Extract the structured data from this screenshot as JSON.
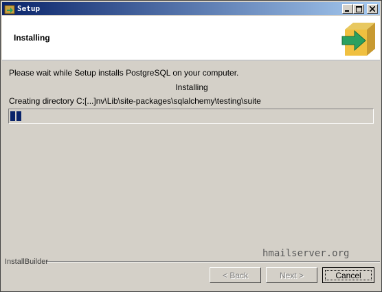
{
  "window": {
    "title": "Setup",
    "controls": {
      "minimize": "_",
      "maximize": "□",
      "close": "X"
    }
  },
  "header": {
    "title": "Installing",
    "icon": "installer-arrow-box-icon"
  },
  "body": {
    "message": "Please wait while Setup installs PostgreSQL on your computer.",
    "status": "Installing",
    "detail": "Creating directory C:[...]nv\\Lib\\site-packages\\sqlalchemy\\testing\\suite",
    "progress_fraction": 0.04
  },
  "watermark": "hmailserver.org",
  "footer": {
    "brand": "InstallBuilder",
    "buttons": {
      "back": "< Back",
      "next": "Next >",
      "cancel": "Cancel"
    }
  },
  "colors": {
    "titlebar_start": "#0a246a",
    "titlebar_end": "#a6caf0",
    "progress_block": "#0a246a",
    "face": "#d4d0c8"
  }
}
